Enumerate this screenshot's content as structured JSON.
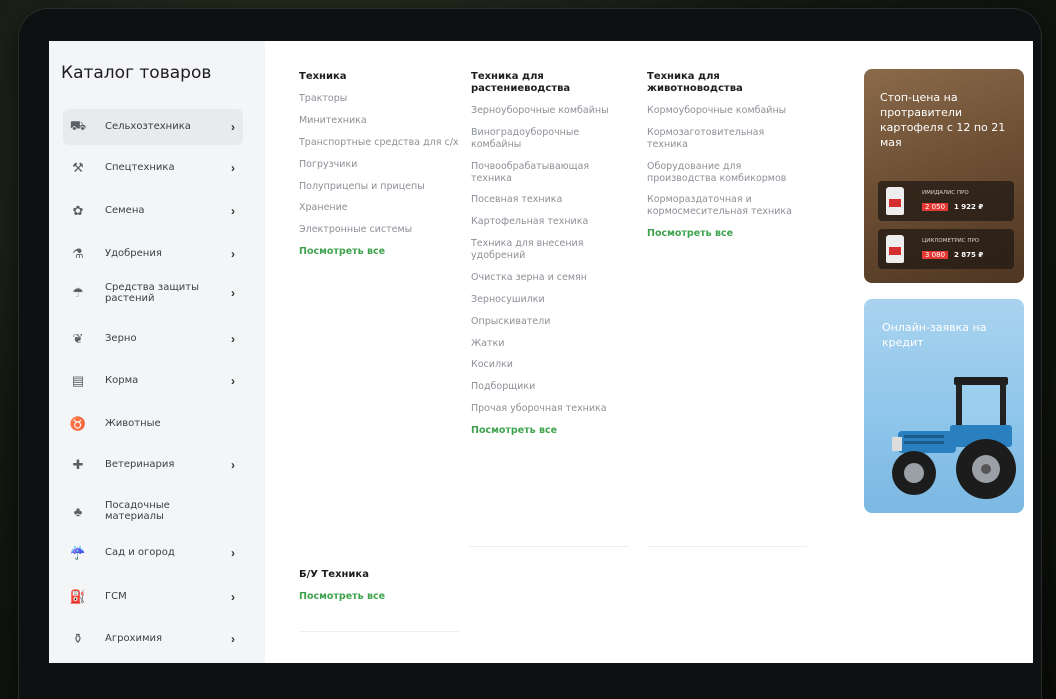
{
  "catalog": {
    "title": "Каталог товаров",
    "items": [
      {
        "label": "Сельхозтехника",
        "icon": "tractor-icon",
        "chevron": true,
        "active": true
      },
      {
        "label": "Спецтехника",
        "icon": "excavator-icon",
        "chevron": true
      },
      {
        "label": "Семена",
        "icon": "seed-icon",
        "chevron": true
      },
      {
        "label": "Удобрения",
        "icon": "fertilizer-icon",
        "chevron": true
      },
      {
        "label": "Средства защиты растений",
        "icon": "sprayer-icon",
        "chevron": true
      },
      {
        "label": "Зерно",
        "icon": "grain-icon",
        "chevron": true
      },
      {
        "label": "Корма",
        "icon": "feed-icon",
        "chevron": true
      },
      {
        "label": "Животные",
        "icon": "cow-icon",
        "chevron": false
      },
      {
        "label": "Ветеринария",
        "icon": "vet-icon",
        "chevron": true
      },
      {
        "label": "Посадочные материалы",
        "icon": "seedling-icon",
        "chevron": false
      },
      {
        "label": "Сад и огород",
        "icon": "watering-can-icon",
        "chevron": true
      },
      {
        "label": "ГСМ",
        "icon": "fuel-icon",
        "chevron": true
      },
      {
        "label": "Агрохимия",
        "icon": "flask-icon",
        "chevron": true
      }
    ],
    "chevron_glyph": "›"
  },
  "columns": [
    {
      "heading": "Техника",
      "links": [
        "Тракторы",
        "Минитехника",
        "Транспортные средства для с/х",
        "Погрузчики",
        "Полуприцепы и прицепы",
        "Хранение",
        "Электронные системы"
      ],
      "see_all": "Посмотреть все"
    },
    {
      "heading": "Техника для растениеводства",
      "links": [
        "Зерноуборочные комбайны",
        "Виноградоуборочные комбайны",
        "Почвообрабатывающая техника",
        "Посевная техника",
        "Картофельная техника",
        "Техника для внесения удобрений",
        "Очистка зерна и семян",
        "Зерносушилки",
        "Опрыскиватели",
        "Жатки",
        "Косилки",
        "Подборщики",
        "Прочая уборочная техника"
      ],
      "see_all": "Посмотреть все"
    },
    {
      "heading": "Техника для животноводства",
      "links": [
        "Кормоуборочные комбайны",
        "Кормозаготовительная техника",
        "Оборудование для производства комбикормов",
        "Кормораздаточная и кормосмесительная техника"
      ],
      "see_all": "Посмотреть все"
    }
  ],
  "used": {
    "heading": "Б/У Техника",
    "see_all": "Посмотреть все"
  },
  "promo_price": {
    "text": "Стоп-цена на протравители картофеля с 12 по 21 мая",
    "products": [
      {
        "name": "ИМИДАЛИС ПРО",
        "old_price": "2 050",
        "price": "1 922 ₽"
      },
      {
        "name": "ЦИКЛОМЕТРИС ПРО",
        "old_price": "3 080",
        "price": "2 875 ₽"
      }
    ]
  },
  "promo_credit": {
    "text": "Онлайн-заявка на кредит"
  },
  "colors": {
    "accent_green": "#3fa34d",
    "tractor_blue": "#2a7fbf"
  }
}
